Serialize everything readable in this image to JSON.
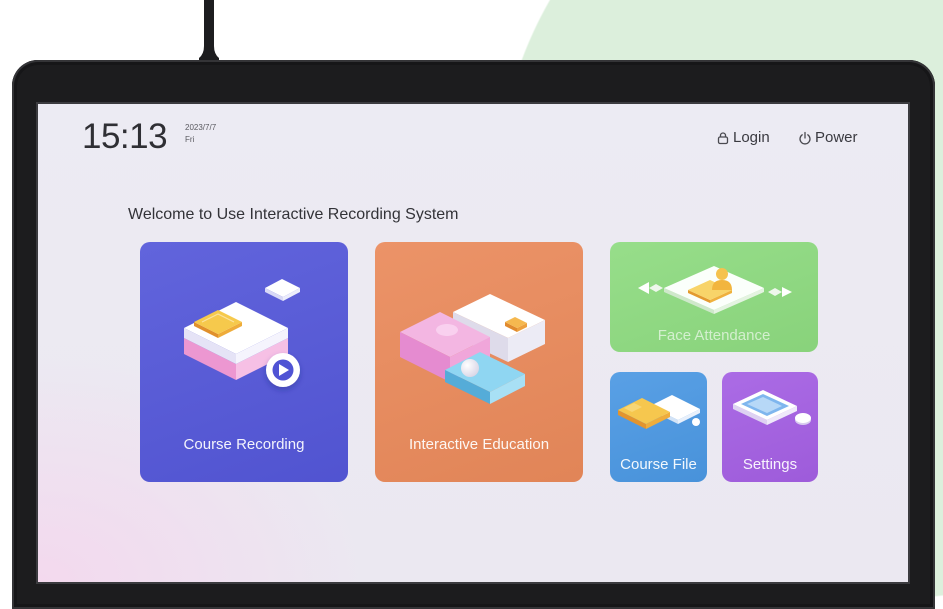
{
  "status_bar": {
    "time": "15:13",
    "date": "2023/7/7",
    "weekday": "Fri",
    "login": {
      "label": "Login",
      "icon": "lock-icon"
    },
    "power": {
      "label": "Power",
      "icon": "power-icon"
    }
  },
  "welcome_text": "Welcome to Use Interactive Recording System",
  "tiles": [
    {
      "label": "Course Recording",
      "color": "#5457d9",
      "icon": "course-recording-illustration"
    },
    {
      "label": "Interactive Education",
      "color": "#ea8a5b",
      "icon": "interactive-education-illustration"
    },
    {
      "label": "Face Attendance",
      "color": "#8edb80",
      "icon": "face-attendance-illustration"
    },
    {
      "label": "Course File",
      "color": "#4b98e3",
      "icon": "course-file-illustration"
    },
    {
      "label": "Settings",
      "color": "#a45fe3",
      "icon": "settings-illustration"
    }
  ]
}
